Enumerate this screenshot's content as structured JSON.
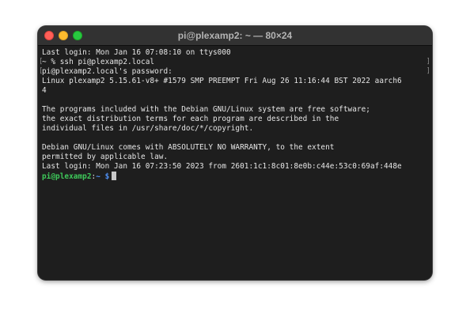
{
  "window": {
    "title": "pi@plexamp2: ~ — 80×24"
  },
  "terminal": {
    "lines": [
      "Last login: Mon Jan 16 07:08:10 on ttys000",
      "~ % ssh pi@plexamp2.local",
      "pi@plexamp2.local's password:",
      "Linux plexamp2 5.15.61-v8+ #1579 SMP PREEMPT Fri Aug 26 11:16:44 BST 2022 aarch6",
      "4",
      "",
      "The programs included with the Debian GNU/Linux system are free software;",
      "the exact distribution terms for each program are described in the",
      "individual files in /usr/share/doc/*/copyright.",
      "",
      "Debian GNU/Linux comes with ABSOLUTELY NO WARRANTY, to the extent",
      "permitted by applicable law.",
      "Last login: Mon Jan 16 07:23:50 2023 from 2601:1c1:8c01:8e0b:c44e:53c0:69af:448e"
    ],
    "prompt": {
      "host": "pi@plexamp2",
      "sep": ":",
      "path": "~",
      "symbol": " $"
    },
    "marks": {
      "left": "[",
      "right": "]"
    }
  },
  "colors": {
    "prompt_host": "#3ec95a",
    "prompt_path": "#4e8ff2",
    "background": "#1e1e1e"
  }
}
